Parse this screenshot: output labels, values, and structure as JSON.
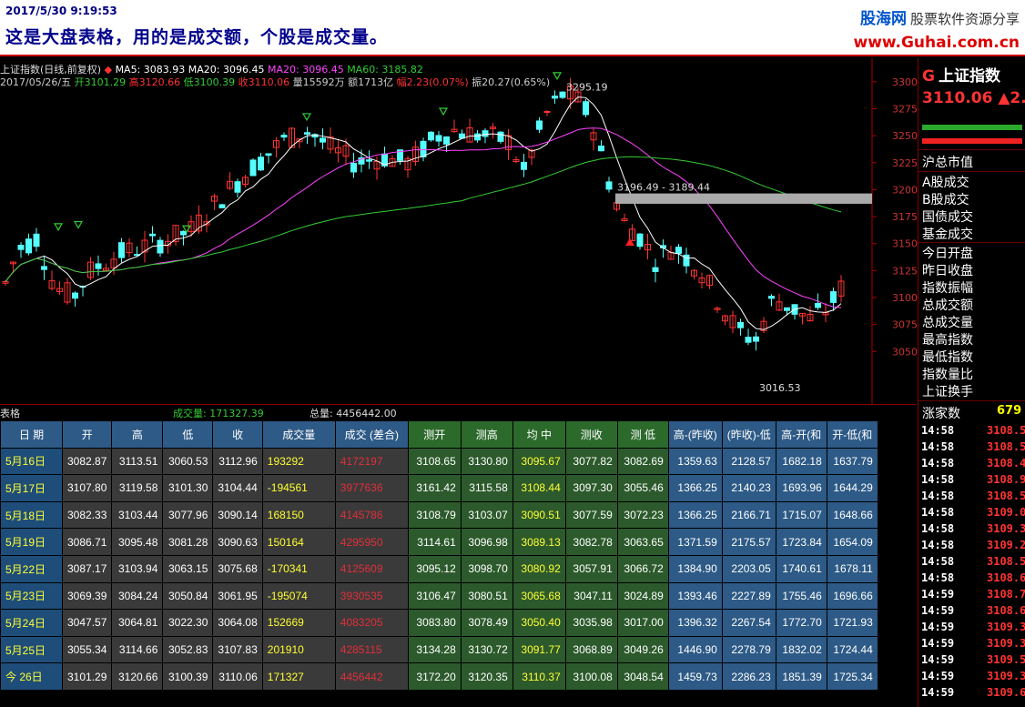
{
  "header": {
    "timestamp": "2017/5/30 9:19:53",
    "note": "这是大盘表格，用的是成交额，个股是成交量。",
    "brand_name": "股海网",
    "brand_slogan": "股票软件资源分享",
    "brand_url": "www.Guhai.com.cn"
  },
  "chart": {
    "legend_line1": {
      "title": "上证指数(日线,前复权)",
      "ma5": "MA5: 3083.93",
      "ma20a": "MA20: 3096.45",
      "ma20b": "MA20: 3096.45",
      "ma60": "MA60: 3185.82"
    },
    "legend_line2": {
      "date": "2017/05/26/五",
      "open": "开3101.29",
      "high": "高3120.66",
      "low": "低3100.39",
      "close": "收3110.06",
      "vol": "量15592万",
      "amt": "额1713亿",
      "range": "幅2.23(0.07%)",
      "amp": "振20.27(0.65%)"
    },
    "annotations": {
      "high_label": "3295.19",
      "low_label": "3016.53",
      "band_label": "3196.49 - 3189.44"
    },
    "yticks": [
      "3300",
      "3275",
      "3250",
      "3225",
      "3200",
      "3175",
      "3150",
      "3125",
      "3100",
      "3075",
      "3050"
    ],
    "colors": {
      "up": "#ff3333",
      "down": "#54ffff",
      "ma5": "#ffffff",
      "ma20": "#ff44ff",
      "ma60": "#33cc33"
    }
  },
  "volume_bar": {
    "label": "表格",
    "vol": "成交量: 171327.39",
    "total": "总量: 4456442.00"
  },
  "side": {
    "code": "G",
    "name": "上证指数",
    "price": "3110.06",
    "change": "▲2.",
    "section1_title": "沪总市值",
    "section1": [
      "A股成交",
      "B股成交",
      "国债成交",
      "基金成交"
    ],
    "section2": [
      "今日开盘",
      "昨日收盘",
      "指数振幅",
      "总成交额",
      "总成交量",
      "最高指数",
      "最低指数",
      "指数量比",
      "上证换手"
    ],
    "up_label": "涨家数",
    "up_count": "679",
    "ticks": [
      {
        "t": "14:58",
        "p": "3108.5"
      },
      {
        "t": "14:58",
        "p": "3108.5"
      },
      {
        "t": "14:58",
        "p": "3108.4"
      },
      {
        "t": "14:58",
        "p": "3108.9"
      },
      {
        "t": "14:58",
        "p": "3108.5"
      },
      {
        "t": "14:58",
        "p": "3109.0"
      },
      {
        "t": "14:58",
        "p": "3109.3"
      },
      {
        "t": "14:58",
        "p": "3109.2"
      },
      {
        "t": "14:58",
        "p": "3108.5"
      },
      {
        "t": "14:58",
        "p": "3108.6"
      },
      {
        "t": "14:59",
        "p": "3108.7"
      },
      {
        "t": "14:59",
        "p": "3108.6"
      },
      {
        "t": "14:59",
        "p": "3109.3"
      },
      {
        "t": "14:59",
        "p": "3109.3"
      },
      {
        "t": "14:59",
        "p": "3109.5"
      },
      {
        "t": "14:59",
        "p": "3109.3"
      },
      {
        "t": "14:59",
        "p": "3109.6"
      }
    ]
  },
  "table": {
    "headers": [
      "日 期",
      "开",
      "高",
      "低",
      "收",
      "成交量",
      "成交 (差合)",
      "测开",
      "测高",
      "均 中",
      "测收",
      "测 低",
      "高-(昨收)",
      "(昨收)-低",
      "高-开(和",
      "开-低(和"
    ],
    "rows": [
      [
        "5月16日",
        "3082.87",
        "3113.51",
        "3060.53",
        "3112.96",
        "193292",
        "4172197",
        "3108.65",
        "3130.80",
        "3095.67",
        "3077.82",
        "3082.69",
        "1359.63",
        "2128.57",
        "1682.18",
        "1637.79"
      ],
      [
        "5月17日",
        "3107.80",
        "3119.58",
        "3101.30",
        "3104.44",
        "-194561",
        "3977636",
        "3161.42",
        "3115.58",
        "3108.44",
        "3097.30",
        "3055.46",
        "1366.25",
        "2140.23",
        "1693.96",
        "1644.29"
      ],
      [
        "5月18日",
        "3082.33",
        "3103.44",
        "3077.96",
        "3090.14",
        "168150",
        "4145786",
        "3108.79",
        "3103.07",
        "3090.51",
        "3077.59",
        "3072.23",
        "1366.25",
        "2166.71",
        "1715.07",
        "1648.66"
      ],
      [
        "5月19日",
        "3086.71",
        "3095.48",
        "3081.28",
        "3090.63",
        "150164",
        "4295950",
        "3114.61",
        "3096.98",
        "3089.13",
        "3082.78",
        "3063.65",
        "1371.59",
        "2175.57",
        "1723.84",
        "1654.09"
      ],
      [
        "5月22日",
        "3087.17",
        "3103.94",
        "3063.15",
        "3075.68",
        "-170341",
        "4125609",
        "3095.12",
        "3098.70",
        "3080.92",
        "3057.91",
        "3066.72",
        "1384.90",
        "2203.05",
        "1740.61",
        "1678.11"
      ],
      [
        "5月23日",
        "3069.39",
        "3084.24",
        "3050.84",
        "3061.95",
        "-195074",
        "3930535",
        "3106.47",
        "3080.51",
        "3065.68",
        "3047.11",
        "3024.89",
        "1393.46",
        "2227.89",
        "1755.46",
        "1696.66"
      ],
      [
        "5月24日",
        "3047.57",
        "3064.81",
        "3022.30",
        "3064.08",
        "152669",
        "4083205",
        "3083.80",
        "3078.49",
        "3050.40",
        "3035.98",
        "3017.00",
        "1396.32",
        "2267.54",
        "1772.70",
        "1721.93"
      ],
      [
        "5月25日",
        "3055.34",
        "3114.66",
        "3052.83",
        "3107.83",
        "201910",
        "4285115",
        "3134.28",
        "3130.72",
        "3091.77",
        "3068.89",
        "3049.26",
        "1446.90",
        "2278.79",
        "1832.02",
        "1724.44"
      ],
      [
        "今 26日",
        "3101.29",
        "3120.66",
        "3100.39",
        "3110.06",
        "171327",
        "4456442",
        "3172.20",
        "3120.35",
        "3110.37",
        "3100.08",
        "3048.54",
        "1459.73",
        "2286.23",
        "1851.39",
        "1725.34"
      ]
    ]
  }
}
